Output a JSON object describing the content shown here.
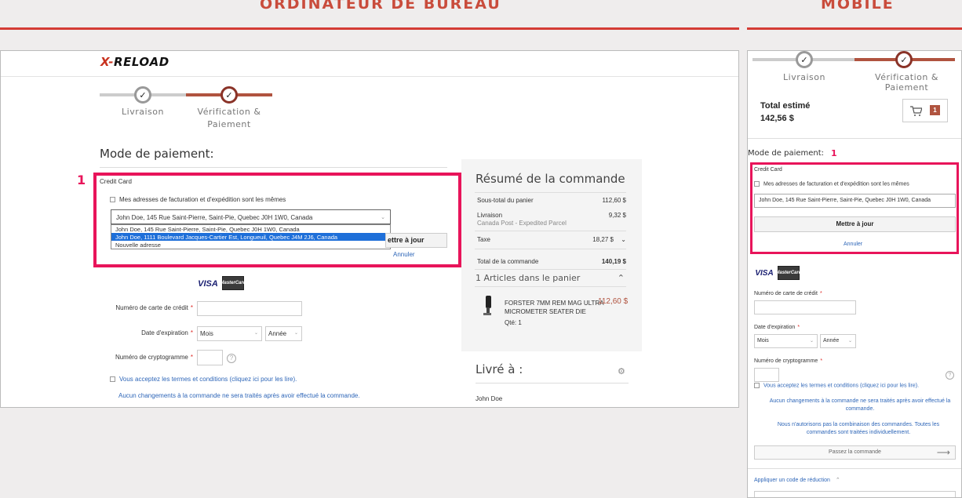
{
  "headings": {
    "desktop": "ORDINATEUR DE BUREAU",
    "mobile": "MOBILE"
  },
  "brand": {
    "logo_x": "X-",
    "logo_rest": "RELOAD",
    "accent": "#d43c35",
    "highlight": "#e8145a"
  },
  "steps": {
    "shipping": "Livraison",
    "review_line1": "Vérification &",
    "review_line2": "Paiement",
    "review_mobile": "Vérification & Paiement",
    "check": "✓"
  },
  "payment": {
    "title": "Mode de paiement:",
    "marker": "1",
    "method": "Credit Card",
    "same_address": "Mes adresses de facturation et d'expédition sont les mêmes",
    "selected_address": "John Doe, 145 Rue Saint-Pierre, Saint-Pie, Quebec J0H 1W0, Canada",
    "options": [
      "John Doe, 145 Rue Saint-Pierre, Saint-Pie, Quebec J0H 1W0, Canada",
      "John Doe, 1111 Boulevard Jacques-Cartier Est, Longueuil, Quebec J4M 2J6, Canada",
      "Nouvelle adresse"
    ],
    "update_desktop": "ettre à jour",
    "update": "Mettre à jour",
    "cancel": "Annuler",
    "visa": "VISA",
    "mastercard": "MasterCard",
    "card_number": "Numéro de carte de crédit",
    "expiry": "Date d'expiration",
    "month": "Mois",
    "year": "Année",
    "cvv": "Numéro de cryptogramme",
    "required": "*",
    "help": "?",
    "terms": "Vous acceptez les termes et conditions (cliquez ici pour les lire).",
    "no_changes": "Aucun changements à la commande ne sera traités après avoir effectué la commande.",
    "no_combine": "Nous n'autorisons pas la combinaison des commandes. Toutes les commandes sont traitées individuellement.",
    "place_order": "Passez la commande",
    "discount": "Appliquer un code de réduction"
  },
  "summary": {
    "title": "Résumé de la commande",
    "subtotal_label": "Sous-total du panier",
    "subtotal": "112,60 $",
    "shipping_label": "Livraison",
    "shipping_method": "Canada Post - Expedited Parcel",
    "shipping": "9,32 $",
    "tax_label": "Taxe",
    "tax": "18,27 $",
    "total_label": "Total de la commande",
    "total": "140,19 $",
    "items_label": "1 Articles dans le panier",
    "product_name_1": "FORSTER 7MM REM MAG ULTRA",
    "product_name_2": "MICROMETER SEATER DIE",
    "product_price": "112,60 $",
    "qty": "Qté: 1"
  },
  "ship_to": {
    "title": "Livré à :",
    "name": "John Doe"
  },
  "mobile": {
    "estimated_label": "Total estimé",
    "estimated_total": "142,56 $",
    "cart_count": "1"
  }
}
